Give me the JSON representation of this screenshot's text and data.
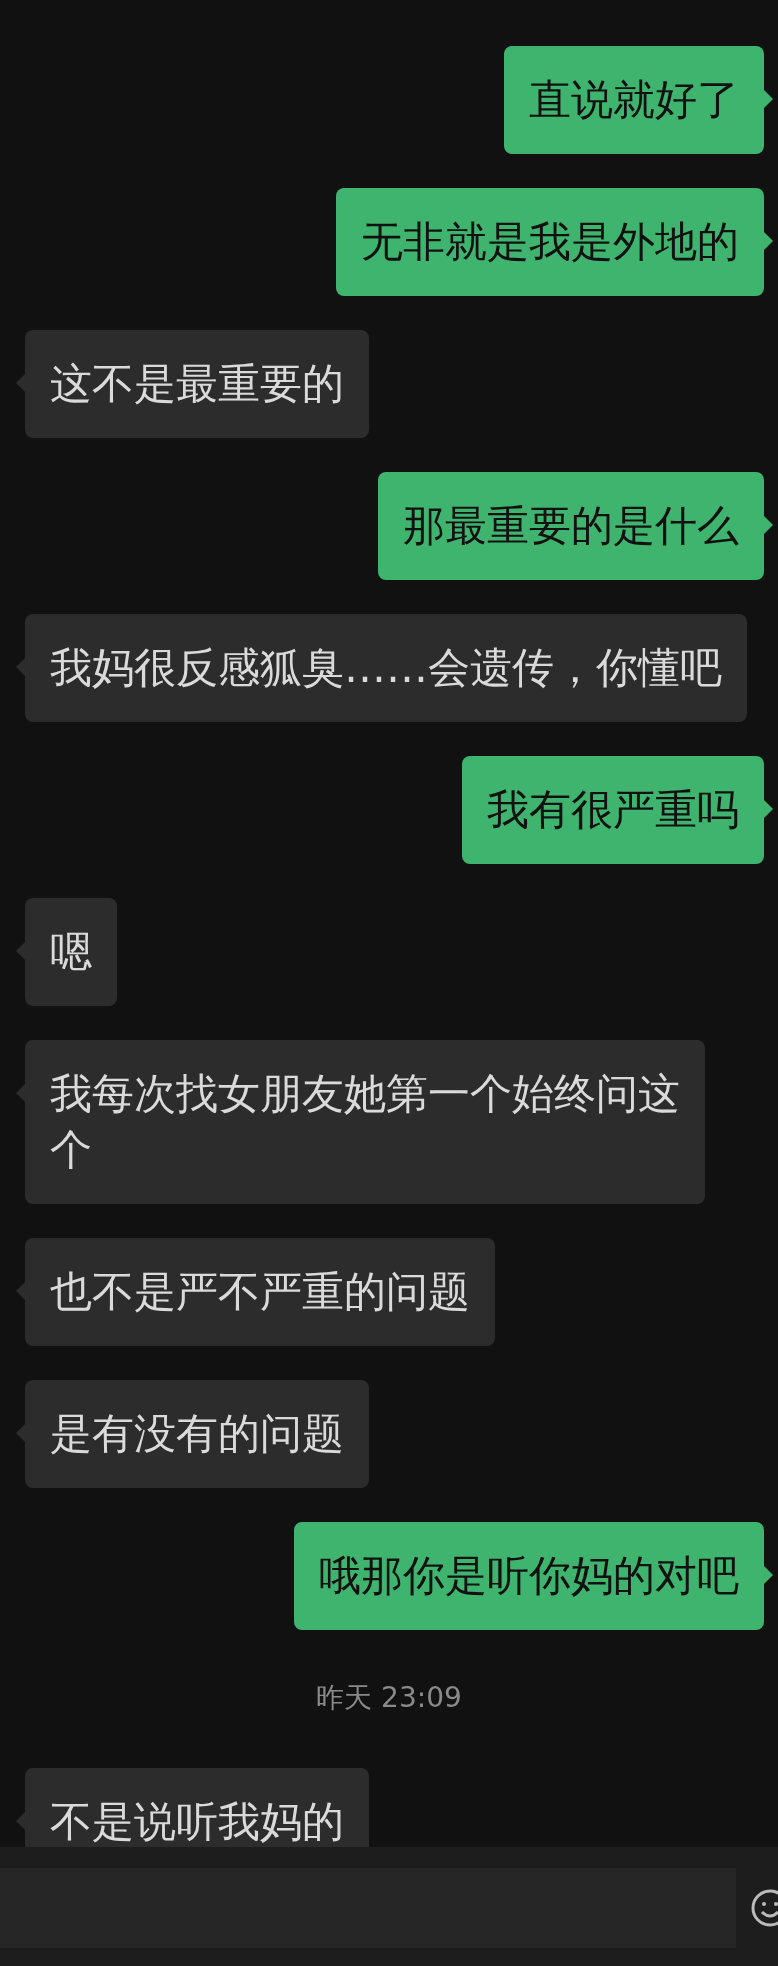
{
  "messages": [
    {
      "kind": "message",
      "outgoing": true,
      "lines": [
        "直说就好了"
      ]
    },
    {
      "kind": "message",
      "outgoing": true,
      "lines": [
        "无非就是我是外地的"
      ]
    },
    {
      "kind": "message",
      "outgoing": false,
      "lines": [
        "这不是最重要的"
      ]
    },
    {
      "kind": "message",
      "outgoing": true,
      "lines": [
        "那最重要的是什么"
      ]
    },
    {
      "kind": "message",
      "outgoing": false,
      "lines": [
        "我妈很反感狐臭……会遗传，你懂吧"
      ]
    },
    {
      "kind": "message",
      "outgoing": true,
      "lines": [
        "我有很严重吗"
      ]
    },
    {
      "kind": "message",
      "outgoing": false,
      "lines": [
        "嗯"
      ]
    },
    {
      "kind": "message",
      "outgoing": false,
      "lines": [
        "我每次找女朋友她第一个始终问这",
        "个"
      ]
    },
    {
      "kind": "message",
      "outgoing": false,
      "lines": [
        "也不是严不严重的问题"
      ]
    },
    {
      "kind": "message",
      "outgoing": false,
      "lines": [
        "是有没有的问题"
      ]
    },
    {
      "kind": "message",
      "outgoing": true,
      "lines": [
        "哦那你是听你妈的对吧"
      ]
    },
    {
      "kind": "time",
      "text": "昨天 23:09"
    },
    {
      "kind": "message",
      "outgoing": false,
      "lines": [
        "不是说听我妈的"
      ]
    }
  ]
}
